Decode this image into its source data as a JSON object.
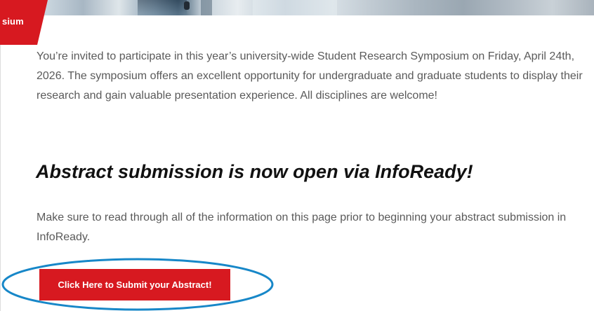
{
  "hero": {
    "tag_label": "sium"
  },
  "intro": {
    "text": "You’re invited to participate in this year’s university-wide Student Research Symposium on Friday, April 24th, 2026. The symposium offers an excellent opportunity for undergraduate and graduate students to display their research and gain valuable presentation experience. All disciplines are welcome!"
  },
  "announcement": {
    "heading": "Abstract submission is now open via InfoReady!",
    "note": "Make sure to read through all of the information on this page prior to beginning your abstract submission in InfoReady."
  },
  "cta": {
    "label": "Click Here to Submit your Abstract!"
  },
  "colors": {
    "accent_red": "#d71920",
    "highlight_blue": "#1787c8",
    "heading_text": "#111111",
    "body_text": "#5a5a5a"
  }
}
